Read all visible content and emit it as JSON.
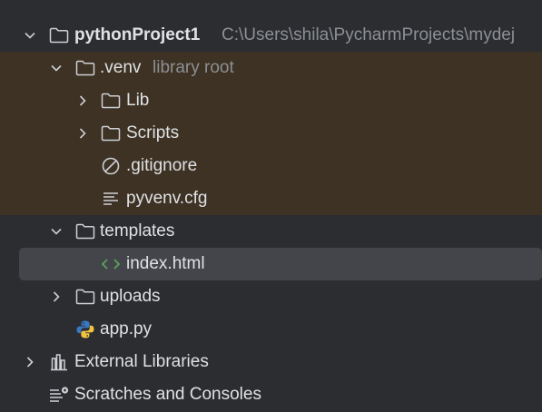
{
  "tree": {
    "project": {
      "name": "pythonProject1",
      "path": "C:\\Users\\shila\\PycharmProjects\\mydej"
    },
    "venv": {
      "name": ".venv",
      "hint": "library root"
    },
    "lib": {
      "name": "Lib"
    },
    "scripts": {
      "name": "Scripts"
    },
    "gitignore": {
      "name": ".gitignore"
    },
    "pyvenv": {
      "name": "pyvenv.cfg"
    },
    "templates": {
      "name": "templates"
    },
    "index_html": {
      "name": "index.html"
    },
    "uploads": {
      "name": "uploads"
    },
    "app_py": {
      "name": "app.py"
    },
    "external_libraries": {
      "name": "External Libraries"
    },
    "scratches": {
      "name": "Scratches and Consoles"
    }
  },
  "colors": {
    "background": "#2b2d30",
    "excluded_highlight": "#3d3223",
    "selection": "#43454a",
    "html_icon": "#5fa25f",
    "python_blue": "#3b78c4",
    "python_yellow": "#f3c33f"
  }
}
